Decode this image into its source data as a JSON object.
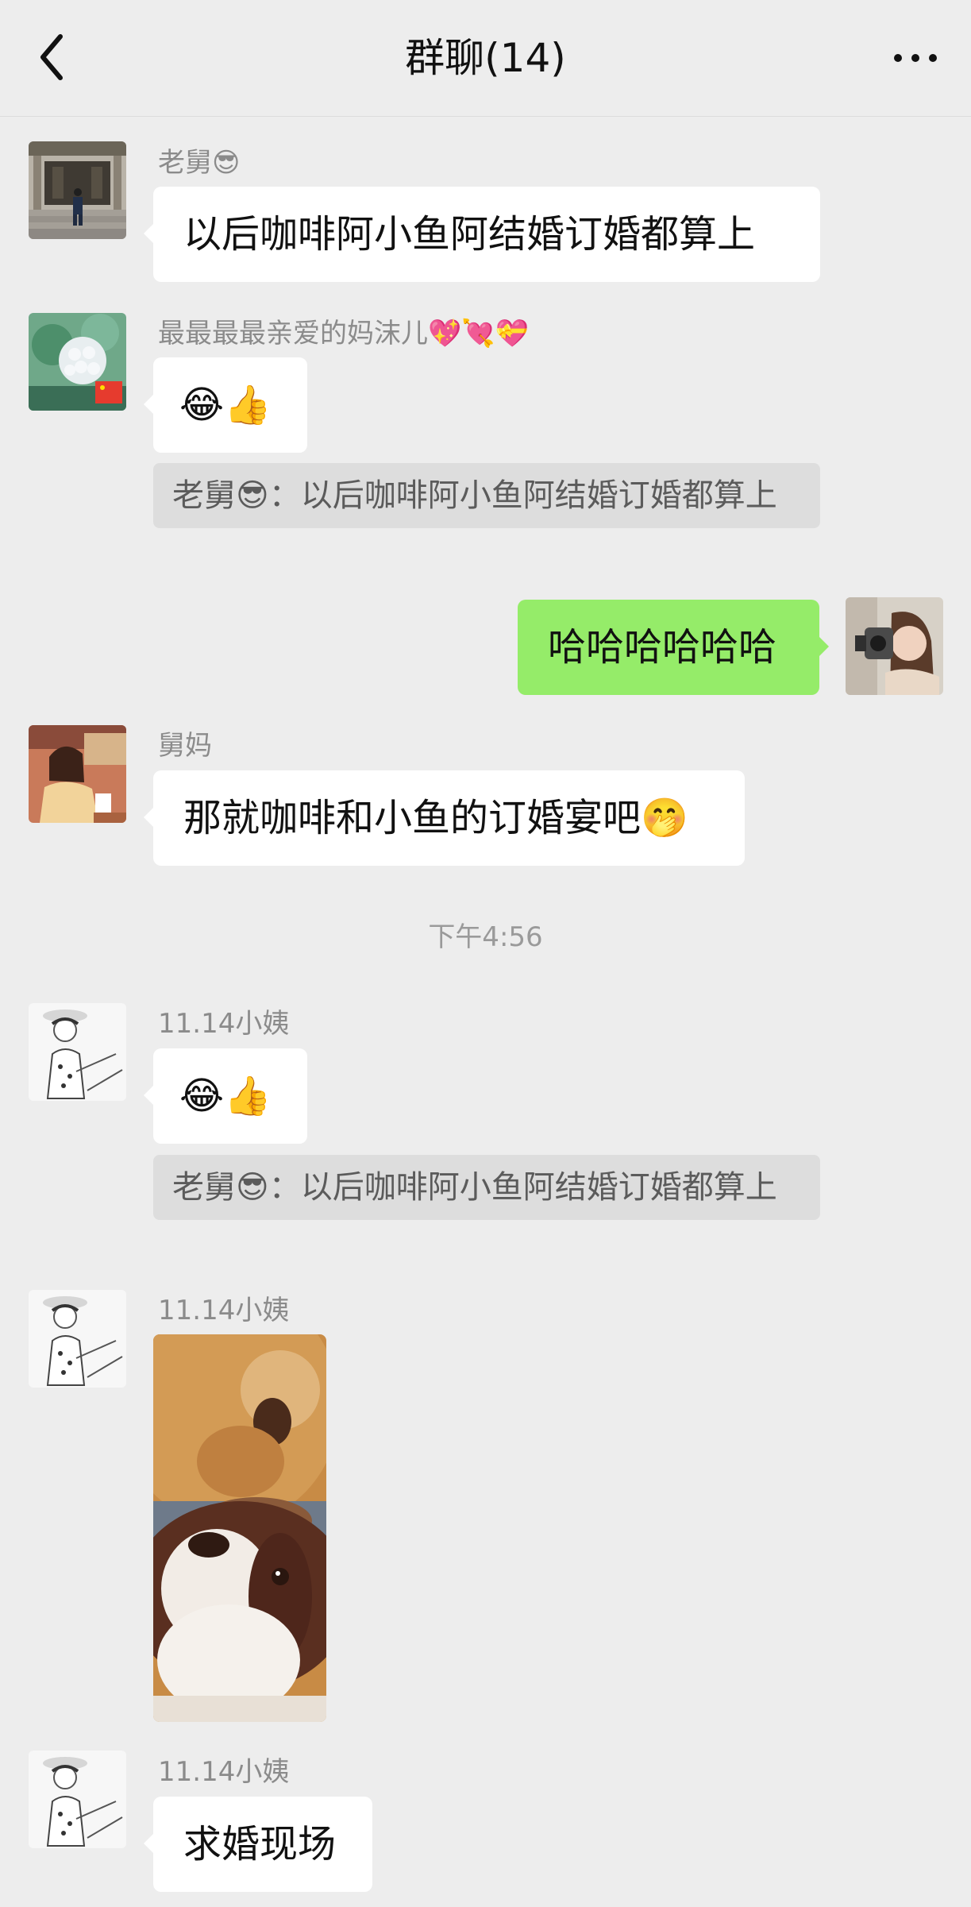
{
  "header": {
    "title": "群聊(14)"
  },
  "messages": [
    {
      "sender": "老舅😎",
      "text": "以后咖啡阿小鱼阿结婚订婚都算上"
    },
    {
      "sender": "最最最最亲爱的妈沫儿💖💘💝",
      "text": "😂👍",
      "quote": "老舅😎：以后咖啡阿小鱼阿结婚订婚都算上"
    },
    {
      "self": true,
      "text": "哈哈哈哈哈哈"
    },
    {
      "sender": "舅妈",
      "text": "那就咖啡和小鱼的订婚宴吧🤭"
    },
    {
      "sender": "11.14小姨",
      "text": "😂👍",
      "quote": "老舅😎：以后咖啡阿小鱼阿结婚订婚都算上"
    },
    {
      "sender": "11.14小姨",
      "image": "dog-photo"
    },
    {
      "sender": "11.14小姨",
      "text": "求婚现场"
    }
  ],
  "timestamp": "下午4:56",
  "icons": {
    "back": "chevron-left-icon",
    "more": "more-horizontal-icon"
  },
  "colors": {
    "background": "#ededed",
    "self_bubble": "#95ec69",
    "other_bubble": "#ffffff",
    "quote_bg": "#dddddd"
  }
}
